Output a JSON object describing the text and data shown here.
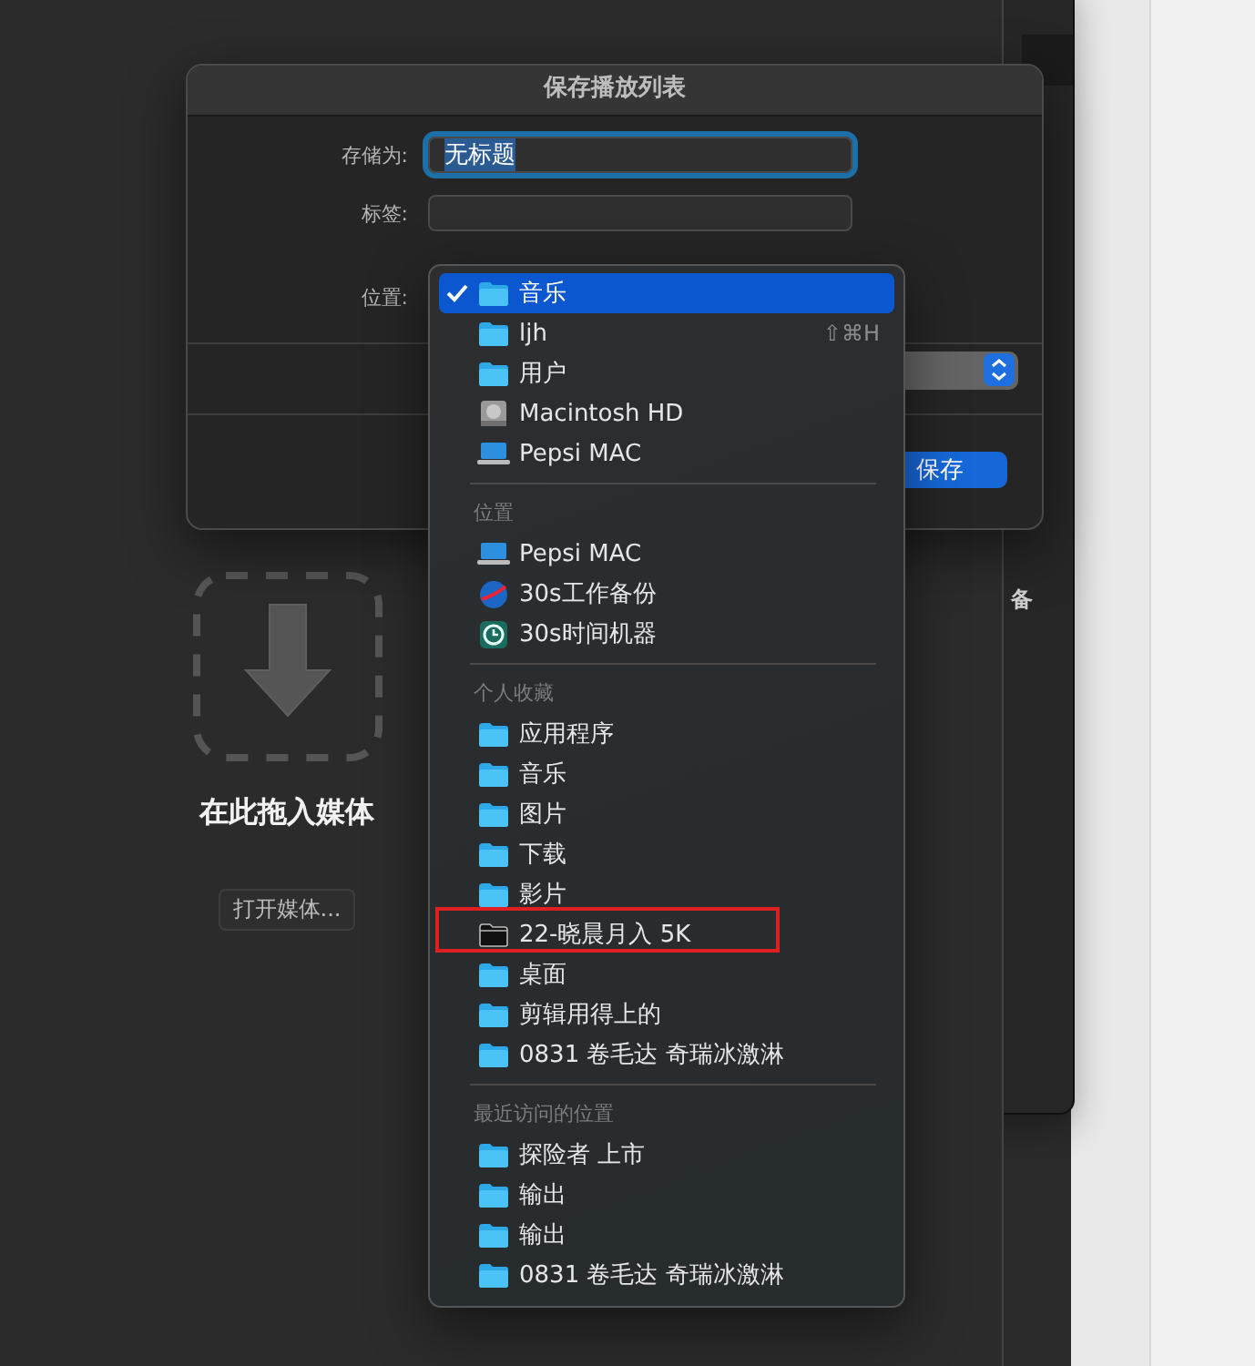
{
  "main_window": {
    "drop_hint": "在此拖入媒体",
    "open_button": "打开媒体..."
  },
  "back_window": {
    "text": "备"
  },
  "dialog": {
    "title": "保存播放列表",
    "save_as": {
      "label": "存储为:",
      "value": "无标题"
    },
    "tags": {
      "label": "标签:"
    },
    "location": {
      "label": "位置:"
    },
    "save_button": "保存"
  },
  "menu": {
    "sections": [
      {
        "items": [
          {
            "label": "音乐",
            "kind": "folder",
            "selected": true
          },
          {
            "label": "ljh",
            "kind": "folder",
            "selected": false,
            "shortcut": "⇧⌘H"
          },
          {
            "label": "用户",
            "kind": "folder",
            "selected": false
          },
          {
            "label": "Macintosh HD",
            "kind": "disk",
            "selected": false
          },
          {
            "label": "Pepsi MAC",
            "kind": "laptop",
            "selected": false
          }
        ]
      },
      {
        "header": "位置",
        "items": [
          {
            "label": "Pepsi MAC",
            "kind": "laptop",
            "selected": false
          },
          {
            "label": "30s工作备份",
            "kind": "badge",
            "selected": false
          },
          {
            "label": "30s时间机器",
            "kind": "clock",
            "selected": false
          }
        ]
      },
      {
        "header": "个人收藏",
        "items": [
          {
            "label": "应用程序",
            "kind": "folder",
            "selected": false
          },
          {
            "label": "音乐",
            "kind": "folder",
            "selected": false
          },
          {
            "label": "图片",
            "kind": "folder",
            "selected": false
          },
          {
            "label": "下载",
            "kind": "folder",
            "selected": false
          },
          {
            "label": "影片",
            "kind": "folder",
            "selected": false
          },
          {
            "label": "22-晓晨月入 5K",
            "kind": "plain-folder",
            "selected": false,
            "marked": true
          },
          {
            "label": "桌面",
            "kind": "folder",
            "selected": false
          },
          {
            "label": "剪辑用得上的",
            "kind": "folder",
            "selected": false
          },
          {
            "label": "0831 卷毛达 奇瑞冰激淋",
            "kind": "folder",
            "selected": false
          }
        ]
      },
      {
        "header": "最近访问的位置",
        "items": [
          {
            "label": "探险者 上市",
            "kind": "folder",
            "selected": false
          },
          {
            "label": "输出",
            "kind": "folder",
            "selected": false
          },
          {
            "label": "输出",
            "kind": "folder",
            "selected": false
          },
          {
            "label": "0831 卷毛达 奇瑞冰激淋",
            "kind": "folder",
            "selected": false
          }
        ]
      }
    ]
  }
}
